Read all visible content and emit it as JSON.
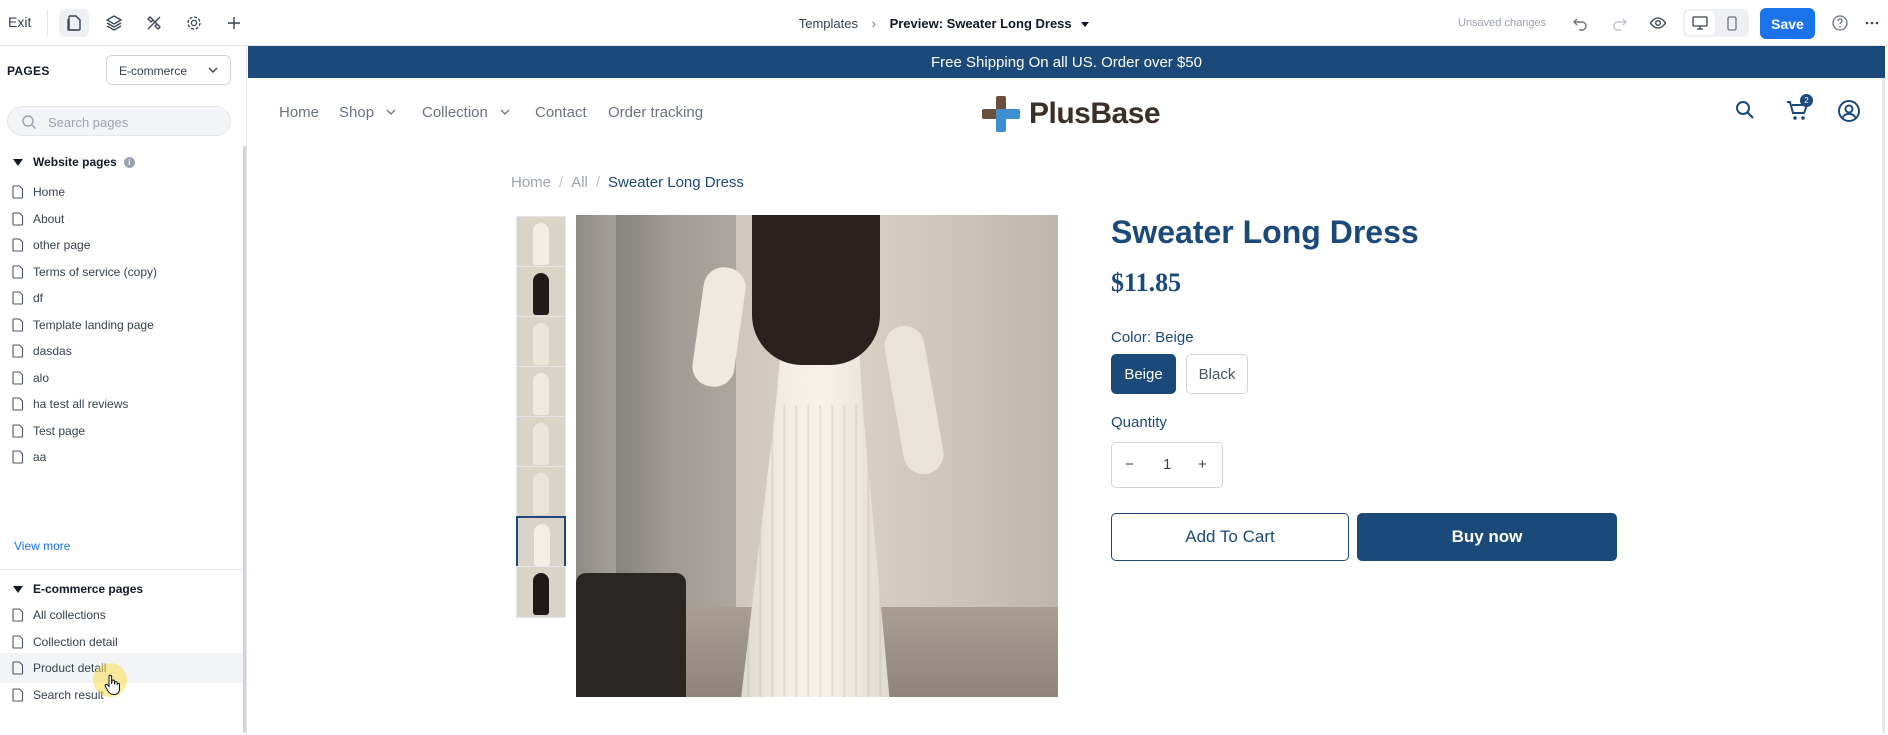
{
  "toolbar": {
    "exit_label": "Exit",
    "icons": [
      "pages-icon",
      "layers-icon",
      "design-icon",
      "settings-icon",
      "add-icon"
    ],
    "breadcrumb": {
      "templates": "Templates",
      "preview": "Preview: Sweater Long Dress"
    },
    "unsaved": "Unsaved changes",
    "save_label": "Save",
    "accent_color": "#1a73e8"
  },
  "sidebar": {
    "heading": "PAGES",
    "page_type": "E-commerce",
    "search_placeholder": "Search pages",
    "website_section": "Website pages",
    "website_pages": [
      "Home",
      "About",
      "other page",
      "Terms of service (copy)",
      "df",
      "Template landing page",
      "dasdas",
      "alo",
      "ha test all reviews",
      "Test page",
      "aa"
    ],
    "view_more": "View more",
    "ecommerce_section": "E-commerce pages",
    "ecommerce_pages": [
      "All collections",
      "Collection detail",
      "Product detail",
      "Search result"
    ]
  },
  "store": {
    "brand_color": "#1b4a7a",
    "announcement": "Free Shipping On all US. Order over $50",
    "nav": {
      "home": "Home",
      "shop": "Shop",
      "collection": "Collection",
      "contact": "Contact",
      "tracking": "Order tracking"
    },
    "logo_text": "PlusBase",
    "cart_count": "2",
    "breadcrumb": {
      "home": "Home",
      "all": "All",
      "current": "Sweater Long Dress"
    },
    "product": {
      "title": "Sweater Long Dress",
      "price": "$11.85",
      "color_label": "Color: Beige",
      "options": [
        "Beige",
        "Black"
      ],
      "selected_option": "Beige",
      "quantity_label": "Quantity",
      "quantity": "1",
      "minus": "−",
      "plus": "+",
      "add_to_cart": "Add To Cart",
      "buy_now": "Buy now",
      "thumbnail_count": 8,
      "selected_thumbnail": 7
    }
  }
}
